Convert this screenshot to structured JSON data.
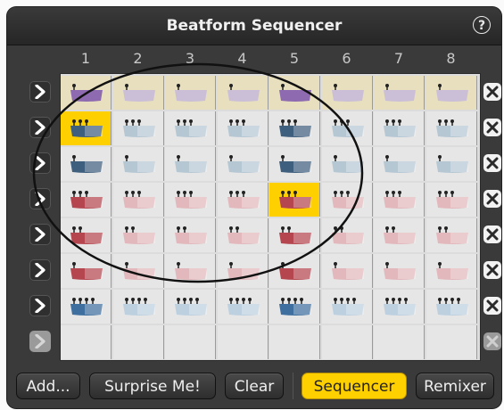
{
  "window": {
    "title": "Beatform Sequencer",
    "help_label": "?"
  },
  "columns": [
    "1",
    "2",
    "3",
    "4",
    "5",
    "6",
    "7",
    "8"
  ],
  "rows": [
    {
      "color": "#8e6bb0",
      "faded": "#cbbfd8",
      "notes": 1,
      "layers": 1
    },
    {
      "color": "#3f5f7e",
      "faded": "#b6c7d4",
      "notes": 3,
      "layers": 2
    },
    {
      "color": "#3f5f7e",
      "faded": "#b6c7d4",
      "notes": 1,
      "layers": 2
    },
    {
      "color": "#b5464f",
      "faded": "#e2b8bc",
      "notes": 3,
      "layers": 2
    },
    {
      "color": "#b5464f",
      "faded": "#e2b8bc",
      "notes": 2,
      "layers": 2
    },
    {
      "color": "#b5464f",
      "faded": "#e2b8bc",
      "notes": 1,
      "layers": 2
    },
    {
      "color": "#3f6f9f",
      "faded": "#bdd0e0",
      "notes": 4,
      "layers": 3
    }
  ],
  "active_cells": [
    {
      "row": 0,
      "col": 0
    },
    {
      "row": 0,
      "col": 4
    },
    {
      "row": 1,
      "col": 0
    },
    {
      "row": 1,
      "col": 4
    },
    {
      "row": 2,
      "col": 0
    },
    {
      "row": 2,
      "col": 4
    },
    {
      "row": 3,
      "col": 0
    },
    {
      "row": 3,
      "col": 4
    },
    {
      "row": 4,
      "col": 0
    },
    {
      "row": 4,
      "col": 4
    },
    {
      "row": 5,
      "col": 0
    },
    {
      "row": 5,
      "col": 4
    },
    {
      "row": 6,
      "col": 0
    },
    {
      "row": 6,
      "col": 4
    }
  ],
  "selected_cells": [
    {
      "row": 1,
      "col": 0
    },
    {
      "row": 3,
      "col": 4
    }
  ],
  "empty_rows": 1,
  "toolbar": {
    "add_label": "Add...",
    "surprise_label": "Surprise Me!",
    "clear_label": "Clear",
    "sequencer_label": "Sequencer",
    "remixer_label": "Remixer"
  },
  "colors": {
    "accent": "#ffd000",
    "panel": "#3a3a3a",
    "row0_bg": "#e8dfbe"
  }
}
